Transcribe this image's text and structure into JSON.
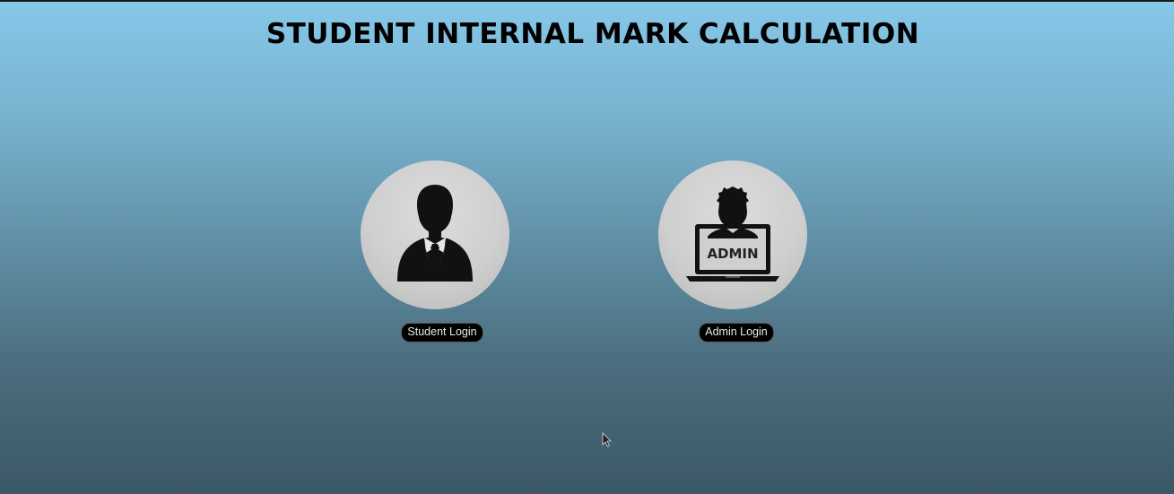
{
  "page": {
    "title": "STUDENT INTERNAL MARK CALCULATION"
  },
  "student": {
    "icon": "student-businessman-icon",
    "button_label": "Student Login"
  },
  "admin": {
    "icon": "admin-laptop-icon",
    "screen_text": "ADMIN",
    "button_label": "Admin Login"
  },
  "colors": {
    "background_top": "#86c8e9",
    "background_bottom": "#3c5866",
    "circle": "#cfcfcf",
    "button_bg": "#000000",
    "button_text": "#e9e9e9"
  }
}
